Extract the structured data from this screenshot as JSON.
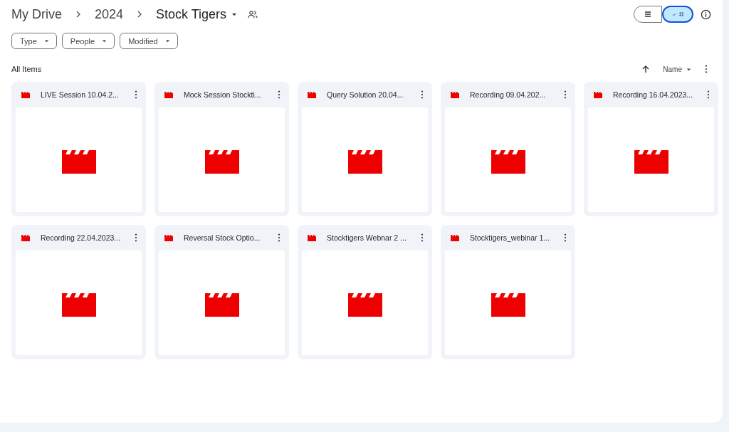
{
  "breadcrumbs": [
    {
      "label": "My Drive"
    },
    {
      "label": "2024"
    },
    {
      "label": "Stock Tigers"
    }
  ],
  "view_toggle": [
    {
      "kind": "list",
      "selected": false
    },
    {
      "kind": "grid",
      "selected": true
    }
  ],
  "filters": [
    {
      "label": "Type"
    },
    {
      "label": "People"
    },
    {
      "label": "Modified"
    }
  ],
  "section_title": "All Items",
  "sort": {
    "label": "Name"
  },
  "files": [
    {
      "name": "LIVE Session 10.04.2..."
    },
    {
      "name": "Mock Session Stockti..."
    },
    {
      "name": "Query Solution 20.04..."
    },
    {
      "name": "Recording 09.04.202..."
    },
    {
      "name": "Recording 16.04.2023..."
    },
    {
      "name": "Recording 22.04.2023..."
    },
    {
      "name": "Reversal Stock Optio..."
    },
    {
      "name": "Stocktigers Webnar 2 ..."
    },
    {
      "name": "Stocktigers_webinar 1..."
    }
  ]
}
